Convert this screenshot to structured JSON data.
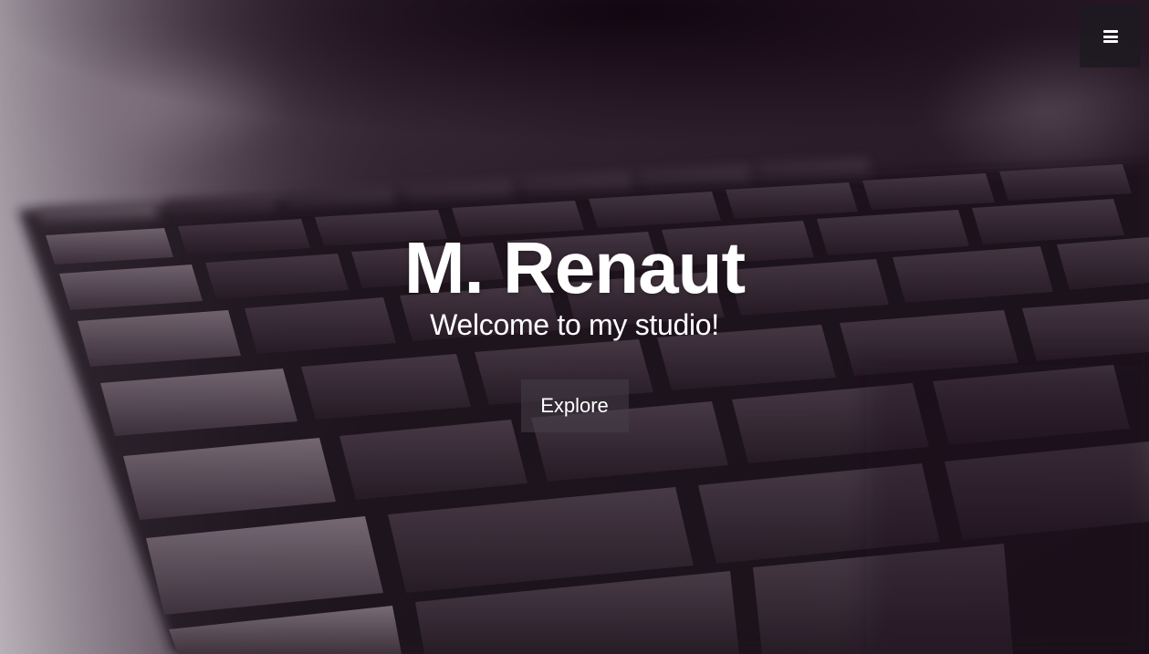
{
  "header": {
    "menu_icon": "hamburger-menu-icon"
  },
  "hero": {
    "title": "M. Renaut",
    "subtitle": "Welcome to my studio!",
    "cta_label": "Explore",
    "background_description_icon": "keyboard-photo",
    "tint_color": "#1a0a1a"
  }
}
